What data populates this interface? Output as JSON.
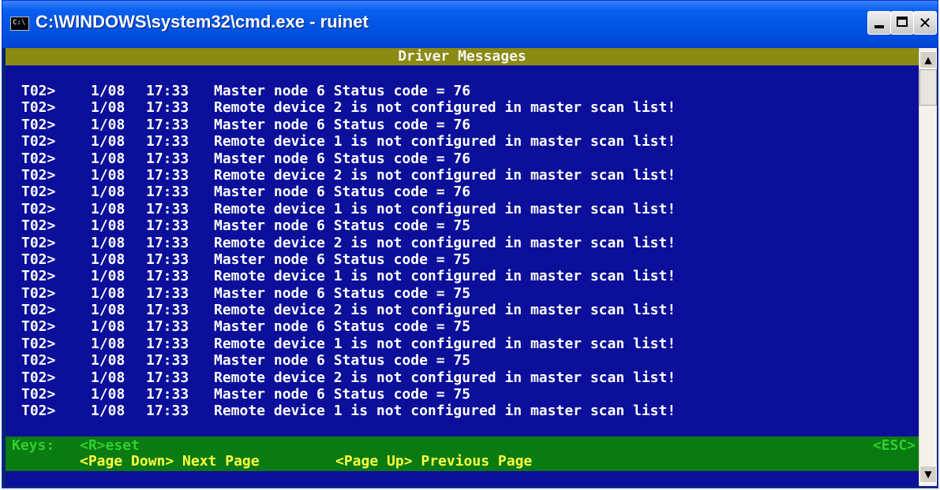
{
  "window": {
    "title": "C:\\WINDOWS\\system32\\cmd.exe - ruinet",
    "icon_label": "C:\\",
    "controls": [
      "minimize",
      "maximize",
      "close"
    ],
    "close_glyph": "✕"
  },
  "console": {
    "header": "Driver Messages",
    "lines": [
      {
        "task": "T02>",
        "date": "1/08",
        "time": "17:33",
        "message": "Master node 6 Status code = 76"
      },
      {
        "task": "T02>",
        "date": "1/08",
        "time": "17:33",
        "message": "Remote device 2 is not configured in master scan list!"
      },
      {
        "task": "T02>",
        "date": "1/08",
        "time": "17:33",
        "message": "Master node 6 Status code = 76"
      },
      {
        "task": "T02>",
        "date": "1/08",
        "time": "17:33",
        "message": "Remote device 1 is not configured in master scan list!"
      },
      {
        "task": "T02>",
        "date": "1/08",
        "time": "17:33",
        "message": "Master node 6 Status code = 76"
      },
      {
        "task": "T02>",
        "date": "1/08",
        "time": "17:33",
        "message": "Remote device 2 is not configured in master scan list!"
      },
      {
        "task": "T02>",
        "date": "1/08",
        "time": "17:33",
        "message": "Master node 6 Status code = 76"
      },
      {
        "task": "T02>",
        "date": "1/08",
        "time": "17:33",
        "message": "Remote device 1 is not configured in master scan list!"
      },
      {
        "task": "T02>",
        "date": "1/08",
        "time": "17:33",
        "message": "Master node 6 Status code = 75"
      },
      {
        "task": "T02>",
        "date": "1/08",
        "time": "17:33",
        "message": "Remote device 2 is not configured in master scan list!"
      },
      {
        "task": "T02>",
        "date": "1/08",
        "time": "17:33",
        "message": "Master node 6 Status code = 75"
      },
      {
        "task": "T02>",
        "date": "1/08",
        "time": "17:33",
        "message": "Remote device 1 is not configured in master scan list!"
      },
      {
        "task": "T02>",
        "date": "1/08",
        "time": "17:33",
        "message": "Master node 6 Status code = 75"
      },
      {
        "task": "T02>",
        "date": "1/08",
        "time": "17:33",
        "message": "Remote device 2 is not configured in master scan list!"
      },
      {
        "task": "T02>",
        "date": "1/08",
        "time": "17:33",
        "message": "Master node 6 Status code = 75"
      },
      {
        "task": "T02>",
        "date": "1/08",
        "time": "17:33",
        "message": "Remote device 1 is not configured in master scan list!"
      },
      {
        "task": "T02>",
        "date": "1/08",
        "time": "17:33",
        "message": "Master node 6 Status code = 75"
      },
      {
        "task": "T02>",
        "date": "1/08",
        "time": "17:33",
        "message": "Remote device 2 is not configured in master scan list!"
      },
      {
        "task": "T02>",
        "date": "1/08",
        "time": "17:33",
        "message": "Master node 6 Status code = 75"
      },
      {
        "task": "T02>",
        "date": "1/08",
        "time": "17:33",
        "message": "Remote device 1 is not configured in master scan list!"
      }
    ]
  },
  "keys": {
    "label": "Keys:",
    "reset": "<R>eset",
    "esc": "<ESC>",
    "page_down": "<Page Down> Next Page",
    "page_up": "<Page Up> Previous Page"
  },
  "colors": {
    "console_bg": "#0b0f9a",
    "header_bg": "#8b8a12",
    "keys_bg": "#0a7a12",
    "keys_text": "#2fd02f",
    "page_keys_text": "#ffff40"
  }
}
